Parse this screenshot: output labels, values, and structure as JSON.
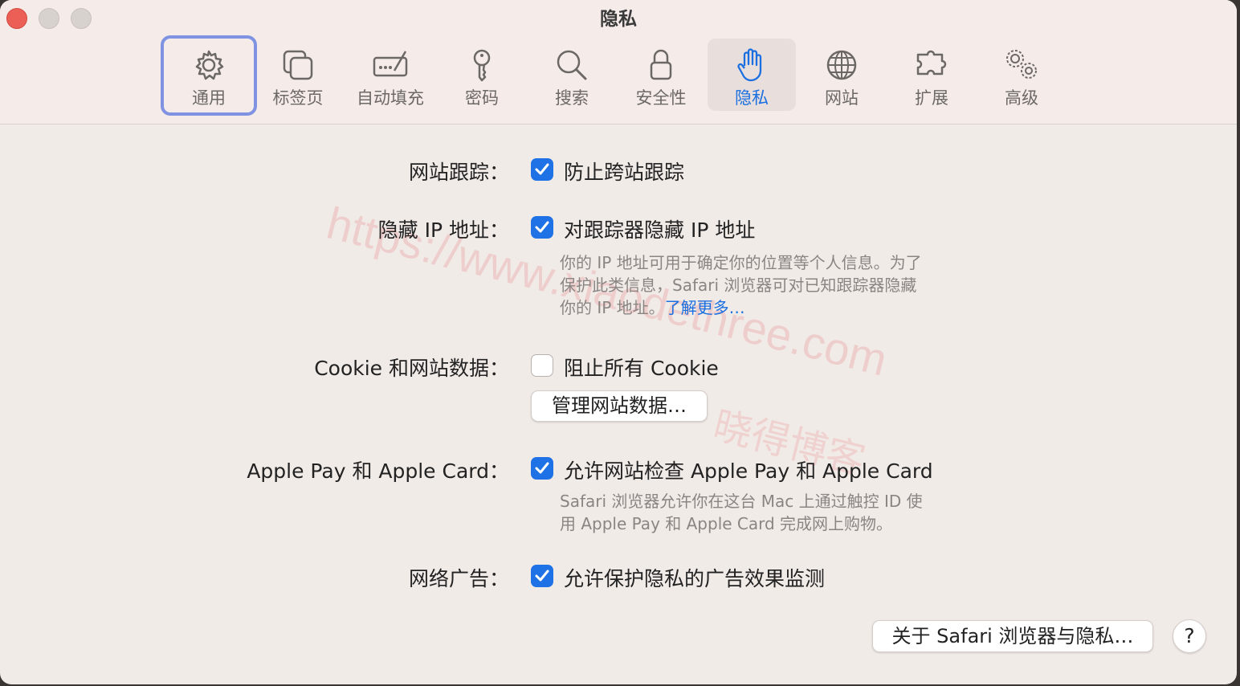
{
  "window": {
    "title": "隐私"
  },
  "toolbar": {
    "items": [
      {
        "label": "通用",
        "icon": "gear-icon"
      },
      {
        "label": "标签页",
        "icon": "tabs-icon"
      },
      {
        "label": "自动填充",
        "icon": "autofill-icon"
      },
      {
        "label": "密码",
        "icon": "key-icon"
      },
      {
        "label": "搜索",
        "icon": "search-icon"
      },
      {
        "label": "安全性",
        "icon": "lock-icon"
      },
      {
        "label": "隐私",
        "icon": "hand-icon"
      },
      {
        "label": "网站",
        "icon": "globe-icon"
      },
      {
        "label": "扩展",
        "icon": "puzzle-icon"
      },
      {
        "label": "高级",
        "icon": "gears-icon"
      }
    ],
    "selected": "隐私",
    "focused": "通用"
  },
  "settings": {
    "tracking": {
      "label": "网站跟踪：",
      "option": "防止跨站跟踪",
      "checked": true
    },
    "hide_ip": {
      "label": "隐藏 IP 地址：",
      "option": "对跟踪器隐藏 IP 地址",
      "checked": true,
      "desc_line1": "你的 IP 地址可用于确定你的位置等个人信息。为了",
      "desc_line2": "保护此类信息，Safari 浏览器可对已知跟踪器隐藏",
      "desc_line3": "你的 IP 地址。",
      "learn_more": "了解更多…"
    },
    "cookies": {
      "label": "Cookie 和网站数据：",
      "option": "阻止所有 Cookie",
      "checked": false,
      "manage_button": "管理网站数据…"
    },
    "apple_pay": {
      "label": "Apple Pay 和 Apple Card：",
      "option": "允许网站检查 Apple Pay 和 Apple Card",
      "checked": true,
      "desc_line1": "Safari 浏览器允许你在这台 Mac 上通过触控 ID 使",
      "desc_line2": "用 Apple Pay 和 Apple Card 完成网上购物。"
    },
    "ads": {
      "label": "网络广告：",
      "option": "允许保护隐私的广告效果监测",
      "checked": true
    }
  },
  "footer": {
    "about_button": "关于 Safari 浏览器与隐私…",
    "help_button": "?"
  },
  "watermark": {
    "url": "https://www.xiaodethree.com",
    "text": "晓得博客"
  },
  "colors": {
    "accent": "#1f72e6",
    "close": "#ec5f56",
    "focus_ring": "#7f93e2"
  }
}
